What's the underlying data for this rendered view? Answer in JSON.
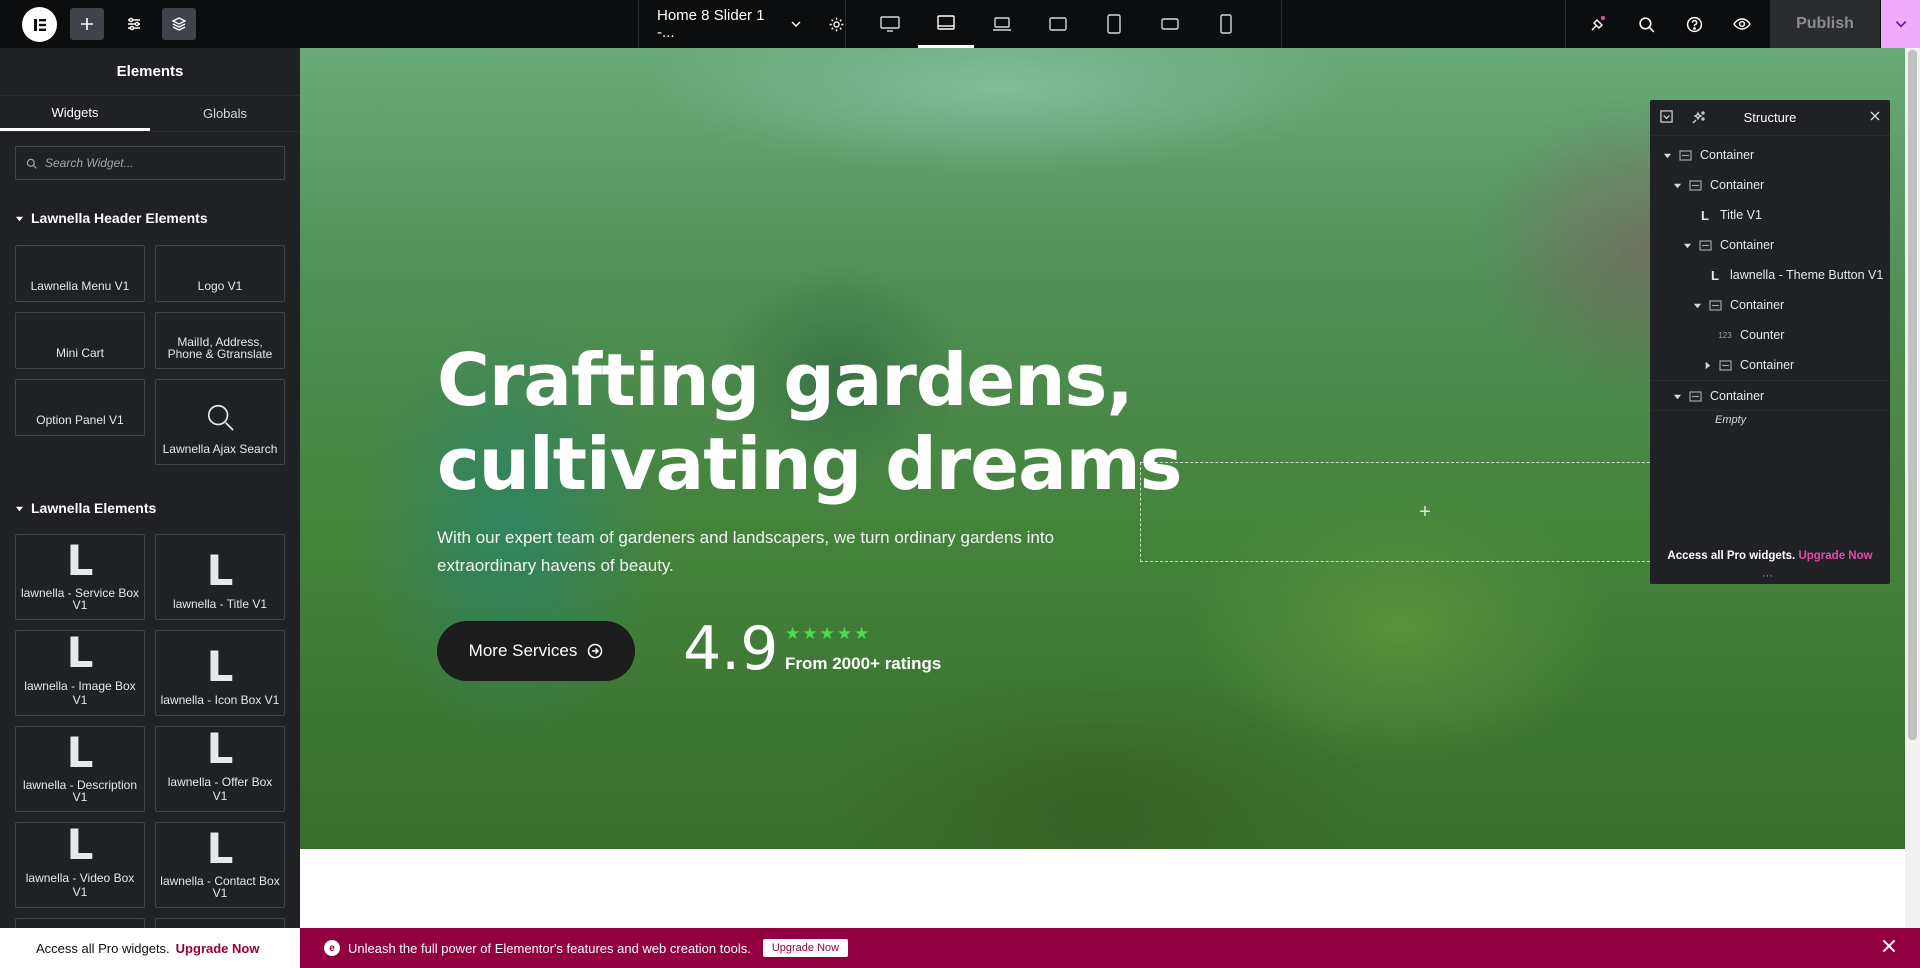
{
  "topbar": {
    "doc_title": "Home 8 Slider 1 -...",
    "publish_label": "Publish",
    "icons": [
      "elementor-logo-icon",
      "plus-icon",
      "sliders-icon",
      "layers-icon",
      "chevron-down-icon",
      "gear-icon",
      "desktop-icon",
      "tablet-landscape-icon",
      "laptop-icon",
      "tablet-icon",
      "tablet-portrait-icon",
      "mobile-landscape-icon",
      "mobile-icon",
      "notifications-icon",
      "search-icon",
      "help-icon",
      "eye-icon"
    ],
    "accent": "#f0abfc"
  },
  "panel": {
    "title": "Elements",
    "tabs": [
      "Widgets",
      "Globals"
    ],
    "search_placeholder": "Search Widget...",
    "cat_header": "Lawnella Header Elements",
    "header_widgets": [
      "Lawnella Menu V1",
      "Logo V1",
      "Mini Cart",
      "MailId, Address, Phone & Gtranslate",
      "Option Panel V1",
      "Lawnella Ajax Search"
    ],
    "cat_elements": "Lawnella Elements",
    "element_icon": "L",
    "element_widgets": [
      "lawnella - Service Box V1",
      "lawnella - Title V1",
      "lawnella - Image Box V1",
      "lawnella - Icon Box V1",
      "lawnella - Description V1",
      "lawnella - Offer Box V1",
      "lawnella - Video Box V1",
      "lawnella - Contact Box V1"
    ],
    "footer_text": "Access all Pro widgets.",
    "footer_link": "Upgrade Now"
  },
  "hero": {
    "title": "Crafting gardens, cultivating dreams",
    "description": "With our expert team of gardeners and landscapers, we turn ordinary gardens into extraordinary havens of beauty.",
    "button_label": "More Services",
    "rating_value": "4.9",
    "rating_stars": 5,
    "rating_text": "From 2000+ ratings",
    "star_color": "#4ade4a",
    "add_icon": "+"
  },
  "structure": {
    "title": "Structure",
    "rows": [
      {
        "label": "Container",
        "icon": "container-icon",
        "expanded": true
      },
      {
        "label": "Container",
        "icon": "container-icon",
        "expanded": true
      },
      {
        "label": "Title V1",
        "icon": "lawnella-icon",
        "expanded": null
      },
      {
        "label": "Container",
        "icon": "container-icon",
        "expanded": true
      },
      {
        "label": "lawnella - Theme Button V1",
        "icon": "lawnella-icon",
        "expanded": null
      },
      {
        "label": "Container",
        "icon": "container-icon",
        "expanded": true
      },
      {
        "label": "Counter",
        "icon": "counter-icon",
        "expanded": null
      },
      {
        "label": "Container",
        "icon": "container-icon",
        "expanded": false
      },
      {
        "label": "Container",
        "icon": "container-icon",
        "expanded": true
      }
    ],
    "counter_icon_text": "123",
    "empty_label": "Empty",
    "footer_text": "Access all Pro widgets.",
    "footer_link": "Upgrade Now",
    "grip": "···"
  },
  "notice": {
    "icon": "e",
    "text": "Unleash the full power of Elementor's features and web creation tools.",
    "button": "Upgrade Now",
    "brand_color": "#93003f"
  }
}
